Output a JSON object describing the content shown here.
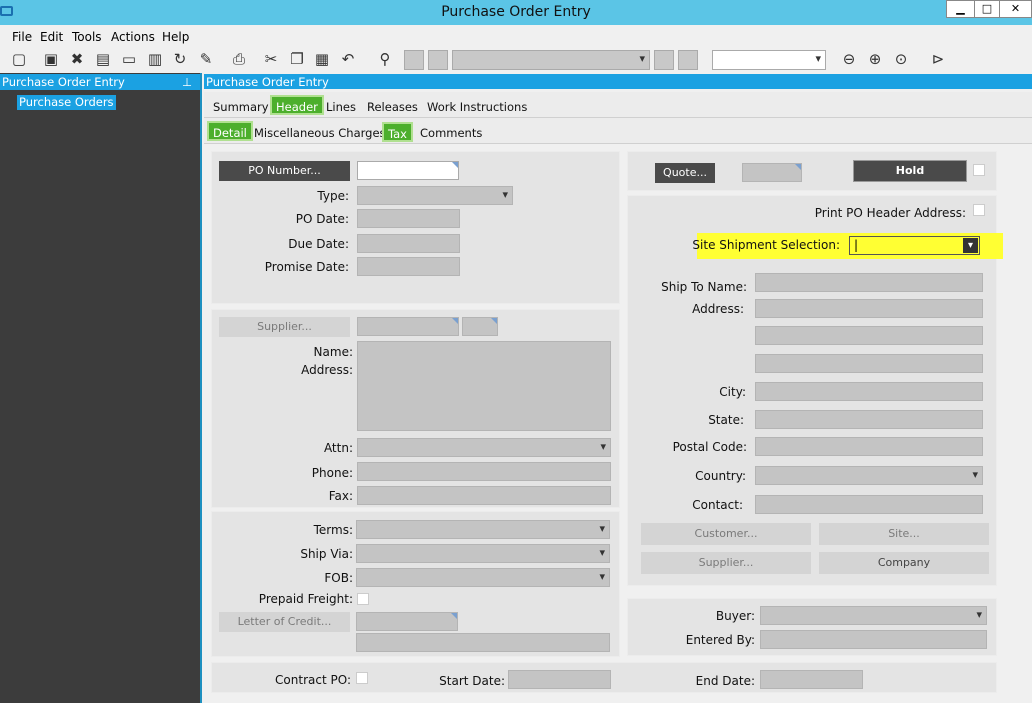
{
  "window": {
    "title": "Purchase Order Entry",
    "min": "▁",
    "max": "□",
    "close": "✕"
  },
  "menu": [
    "File",
    "Edit",
    "Tools",
    "Actions",
    "Help"
  ],
  "left_panel": {
    "title": "Purchase Order Entry",
    "pin": "⊥",
    "tree_item": "Purchase Orders"
  },
  "main_panel": {
    "title": "Purchase Order Entry"
  },
  "tabs": [
    "Summary",
    "Header",
    "Lines",
    "Releases",
    "Work Instructions"
  ],
  "subtabs": [
    "Detail",
    "Miscellaneous Charges",
    "Tax",
    "Comments"
  ],
  "po": {
    "po_number_btn": "PO Number...",
    "type": "Type:",
    "po_date": "PO Date:",
    "due_date": "Due Date:",
    "promise_date": "Promise Date:"
  },
  "supplier": {
    "btn": "Supplier...",
    "name": "Name:",
    "address": "Address:",
    "attn": "Attn:",
    "phone": "Phone:",
    "fax": "Fax:"
  },
  "terms": {
    "terms": "Terms:",
    "ship_via": "Ship Via:",
    "fob": "FOB:",
    "prepaid": "Prepaid Freight:",
    "loc_btn": "Letter of Credit..."
  },
  "contract": {
    "contract_po": "Contract PO:",
    "start_date": "Start Date:",
    "end_date": "End Date:"
  },
  "right": {
    "quote_btn": "Quote...",
    "hold_btn": "Hold",
    "print_addr": "Print PO Header Address:",
    "site_ship": "Site Shipment Selection:",
    "site_ship_value": "|",
    "ship_to_name": "Ship To Name:",
    "address": "Address:",
    "city": "City:",
    "state": "State:",
    "postal": "Postal Code:",
    "country": "Country:",
    "contact": "Contact:",
    "customer_btn": "Customer...",
    "site_btn": "Site...",
    "supplier_btn": "Supplier...",
    "company_btn": "Company"
  },
  "buyer": {
    "buyer": "Buyer:",
    "entered_by": "Entered By:"
  },
  "colors": {
    "accent": "#1ba1e2",
    "tab_active": "#4caf2c",
    "highlight": "#ffff33"
  },
  "toolbar_icons": [
    "new-icon",
    "save-icon",
    "delete-icon",
    "book-icon",
    "note-icon",
    "clipboard-icon",
    "refresh-icon",
    "clear-icon",
    "print-icon",
    "cut-icon",
    "copy-icon",
    "paste-icon",
    "undo-icon",
    "binoculars-icon",
    "first-icon",
    "prev-icon",
    "next-icon",
    "last-icon",
    "back-icon",
    "forward-icon",
    "home-icon",
    "play-icon"
  ]
}
